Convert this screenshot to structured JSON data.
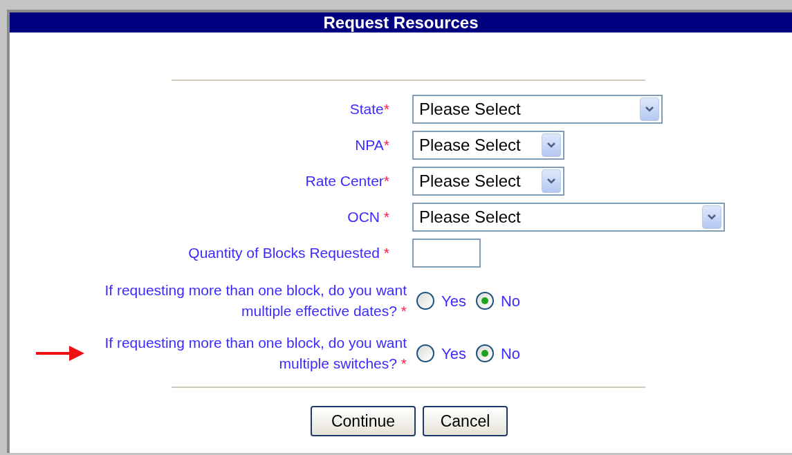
{
  "window": {
    "title": "Request Resources"
  },
  "selects": [
    {
      "label": "State",
      "mark": "*",
      "value": "Please Select"
    },
    {
      "label": "NPA",
      "mark": "*",
      "value": "Please Select"
    },
    {
      "label": "Rate Center",
      "mark": "*",
      "value": "Please Select"
    },
    {
      "label": "OCN ",
      "mark": "*",
      "value": "Please Select"
    }
  ],
  "quantity": {
    "label": "Quantity of Blocks Requested ",
    "mark": "*"
  },
  "questions": [
    {
      "label": "If requesting more than one block, do you want multiple effective dates? ",
      "mark": "*",
      "highlighted": false,
      "options": [
        {
          "label": "Yes",
          "selected": false
        },
        {
          "label": "No",
          "selected": true
        }
      ]
    },
    {
      "label": "If requesting more than one block, do you want multiple switches? ",
      "mark": "*",
      "highlighted": true,
      "options": [
        {
          "label": "Yes",
          "selected": false
        },
        {
          "label": "No",
          "selected": true
        }
      ]
    }
  ],
  "buttons": [
    "Continue",
    "Cancel"
  ]
}
